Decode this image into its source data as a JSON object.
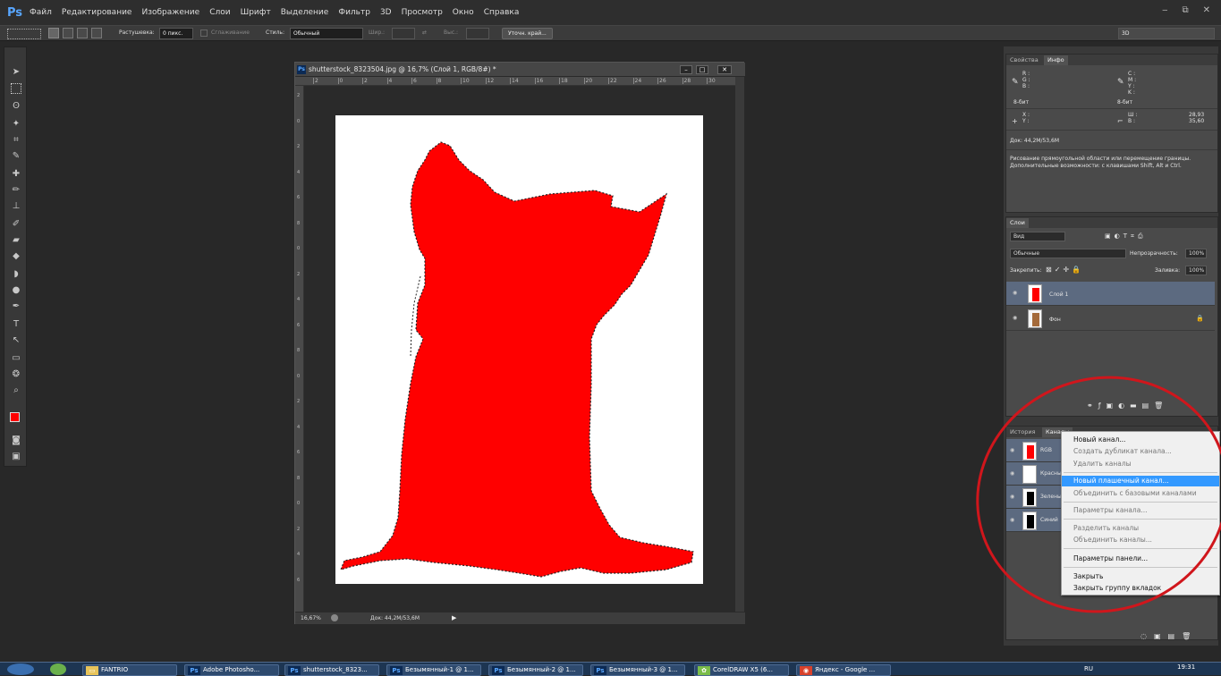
{
  "app": {
    "logo": "Ps",
    "menu": [
      "Файл",
      "Редактирование",
      "Изображение",
      "Слои",
      "Шрифт",
      "Выделение",
      "Фильтр",
      "3D",
      "Просмотр",
      "Окно",
      "Справка"
    ],
    "window_controls": [
      "‒",
      "⧉",
      "✕"
    ]
  },
  "options_bar": {
    "feather_label": "Растушевка:",
    "feather_value": "0 пикс.",
    "antialias_label": "Сглаживание",
    "style_label": "Стиль:",
    "style_value": "Обычный",
    "width_label": "Шир.:",
    "height_label": "Выс.:",
    "refine_button": "Уточн. край...",
    "workspace_value": "3D"
  },
  "document": {
    "title": "shutterstock_8323504.jpg @ 16,7% (Слой 1, RGB/8#) *",
    "ruler_h_ticks": [
      "2",
      "0",
      "2",
      "4",
      "6",
      "8",
      "10",
      "12",
      "14",
      "16",
      "18",
      "20",
      "22",
      "24",
      "26",
      "28",
      "30"
    ],
    "ruler_v_ticks": [
      "2",
      "0",
      "2",
      "4",
      "6",
      "8",
      "0",
      "2",
      "4",
      "6",
      "8",
      "0",
      "2",
      "4",
      "6",
      "8",
      "0",
      "2",
      "4",
      "6"
    ],
    "zoom": "16,67%",
    "doc_size": "Док: 44,2M/53,6M",
    "fill_color": "#ff0000"
  },
  "info_panel": {
    "tabs": [
      "Свойства",
      "Инфо"
    ],
    "active_tab": "Инфо",
    "rgb_labels": "R :\nG :\nB :",
    "cmyk_labels": "C :\nM :\nY :\nK :",
    "bit_depth_left": "8-бит",
    "bit_depth_right": "8-бит",
    "xy_labels": "X :\nY :",
    "wh_labels": "Ш :\nВ :",
    "w_value": "28,93",
    "h_value": "35,60",
    "doc_info": "Док: 44,2M/53,6M",
    "hint_line1": "Рисование прямоугольной области или перемещение границы.",
    "hint_line2": "Дополнительные возможности: с клавишами Shift, Alt и Ctrl."
  },
  "layers_panel": {
    "tab": "Слои",
    "filter": "Вид",
    "blend_mode": "Обычные",
    "opacity_label": "Непрозрачность:",
    "opacity_value": "100%",
    "lock_label": "Закрепить:",
    "fill_label": "Заливка:",
    "fill_value": "100%",
    "layers": [
      {
        "name": "Слой 1",
        "selected": true
      },
      {
        "name": "Фон",
        "selected": false
      }
    ],
    "lock_icon": "🔒"
  },
  "channels_panel": {
    "tabs": [
      "История",
      "Каналы"
    ],
    "active_tab": "Каналы",
    "channels": [
      "RGB",
      "Красный",
      "Зеленый",
      "Синий"
    ]
  },
  "context_menu": {
    "items": [
      {
        "label": "Новый канал...",
        "state": "enabled"
      },
      {
        "label": "Создать дубликат канала...",
        "state": "disabled"
      },
      {
        "label": "Удалить каналы",
        "state": "disabled"
      },
      {
        "label": "Новый плашечный канал...",
        "state": "highlighted"
      },
      {
        "label": "Объединить с базовыми каналами",
        "state": "disabled"
      },
      {
        "label": "Параметры канала...",
        "state": "disabled"
      },
      {
        "label": "Разделить каналы",
        "state": "disabled"
      },
      {
        "label": "Объединить каналы...",
        "state": "disabled"
      },
      {
        "label": "Параметры панели...",
        "state": "enabled"
      },
      {
        "label": "Закрыть",
        "state": "enabled"
      },
      {
        "label": "Закрыть группу вкладок",
        "state": "enabled"
      }
    ]
  },
  "taskbar": {
    "buttons": [
      "FANTRIO",
      "Adobe Photosho...",
      "shutterstock_8323...",
      "Безымянный-1 @ 1...",
      "Безымянный-2 @ 1...",
      "Безымянный-3 @ 1...",
      "CorelDRAW X5 (6...",
      "Яндекс - Google ..."
    ],
    "lang": "RU",
    "time": "19:31"
  }
}
